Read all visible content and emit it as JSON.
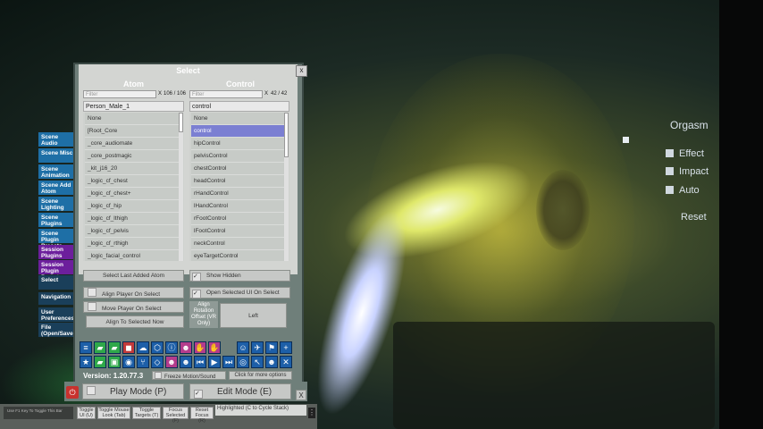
{
  "select_panel": {
    "title": "Select",
    "atom_header": "Atom",
    "control_header": "Control",
    "atom_filter_placeholder": "Filter",
    "atom_count": "106 / 106",
    "control_filter_placeholder": "Filter",
    "control_count": "42 / 42",
    "clear_label": "X",
    "close_label": "x",
    "selected_atom": "Person_Male_1",
    "selected_control": "control",
    "atoms": [
      "None",
      "[Root_Core",
      "_core_audiomate",
      "_core_postmagic",
      "_kit_j16_20",
      "_logic_cf_chest",
      "_logic_cf_chest+",
      "_logic_cf_hip",
      "_logic_cf_lthigh",
      "_logic_cf_pelvis",
      "_logic_cf_rthigh",
      "_logic_facial_control"
    ],
    "controls": [
      "None",
      "control",
      "hipControl",
      "pelvisControl",
      "chestControl",
      "headControl",
      "rHandControl",
      "lHandControl",
      "rFootControl",
      "lFootControl",
      "neckControl",
      "eyeTargetControl"
    ],
    "active_control_index": 1,
    "select_last_added_atom": "Select Last Added Atom",
    "show_hidden": "Show Hidden",
    "align_player_on_select": "Align Player On Select",
    "open_selected_ui_on_select": "Open Selected UI On Select",
    "move_player_on_select": "Move Player On Select",
    "align_to_selected_now": "Align To Selected Now",
    "align_rotation_offset": "Align Rotation Offset (VR Only)",
    "align_rotation_value": "Left"
  },
  "tabs": [
    {
      "label": "Scene Audio",
      "style": "blue"
    },
    {
      "label": "Scene Misc",
      "style": "blue"
    },
    {
      "label": "Scene Animation",
      "style": "blue"
    },
    {
      "label": "Scene Add Atom",
      "style": "blue"
    },
    {
      "label": "Scene Lighting",
      "style": "blue"
    },
    {
      "label": "Scene Plugins",
      "style": "blue"
    },
    {
      "label": "Scene Plugin Presets",
      "style": "blue"
    },
    {
      "label": "Session Plugins",
      "style": "purple"
    },
    {
      "label": "Session Plugin Presets",
      "style": "purple"
    },
    {
      "label": "Select",
      "style": "dark"
    },
    {
      "label": "Navigation",
      "style": "dark"
    },
    {
      "label": "User Preferences",
      "style": "dark"
    },
    {
      "label": "File (Open/Save)",
      "style": "dark"
    }
  ],
  "toolbar": {
    "version": "Version: 1.20.77.3",
    "freeze_motion": "Freeze Motion/Sound",
    "more_options": "Click for more options",
    "play_mode": "Play Mode (P)",
    "edit_mode": "Edit Mode (E)",
    "close_label": "X"
  },
  "bottom_bar": {
    "hint_text": "Use F1 Key To Toggle This Bar",
    "buttons": [
      "Toggle UI (U)",
      "Toggle Mouse Look (Tab)",
      "Toggle Targets (T)",
      "Focus Selected (F)",
      "Reset Focus (R)"
    ],
    "status": "Highlighted (C to Cycle Stack)"
  },
  "right_menu": {
    "orgasm": "Orgasm",
    "effect": "Effect",
    "impact": "Impact",
    "auto": "Auto",
    "reset": "Reset"
  },
  "colors": {
    "tab_blue": "#1e6fa6",
    "tab_purple": "#6c1f9c",
    "selected_row": "#7b7fd2",
    "toolbar_icon": "#1d5fa8"
  }
}
